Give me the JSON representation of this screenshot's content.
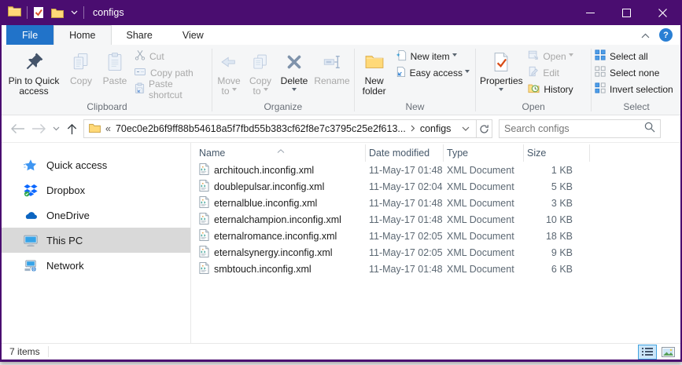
{
  "window": {
    "title": "configs"
  },
  "colors": {
    "titlebar_accent": "#4a0d70",
    "file_tab_blue": "#2173c9",
    "sidebar_selection": "#d9d9d9",
    "active_view_toggle_bg": "#cbe6f9",
    "active_view_toggle_border": "#42a3e0"
  },
  "icons": {
    "help_glyph": "?",
    "breadcrumb_overflow": "«"
  },
  "ribbon": {
    "tabs": {
      "file": "File",
      "home": "Home",
      "share": "Share",
      "view": "View"
    },
    "clipboard": {
      "label": "Clipboard",
      "pin": "Pin to Quick access",
      "copy": "Copy",
      "paste": "Paste",
      "cut": "Cut",
      "copy_path": "Copy path",
      "paste_shortcut": "Paste shortcut"
    },
    "organize": {
      "label": "Organize",
      "move_to": "Move to",
      "copy_to": "Copy to",
      "delete": "Delete",
      "rename": "Rename"
    },
    "new_group": {
      "label": "New",
      "new_folder": "New folder",
      "new_item": "New item",
      "easy_access": "Easy access"
    },
    "open_group": {
      "label": "Open",
      "properties": "Properties",
      "open": "Open",
      "edit": "Edit",
      "history": "History"
    },
    "select_group": {
      "label": "Select",
      "select_all": "Select all",
      "select_none": "Select none",
      "invert": "Invert selection"
    }
  },
  "address": {
    "parent": "70ec0e2b6f9ff88b54618a5f7fbd55b383cf62f8e7c3795c25e2f613...",
    "current": "configs",
    "search_placeholder": "Search configs"
  },
  "sidebar": {
    "items": [
      {
        "label": "Quick access",
        "icon": "quick-access-star-icon",
        "selected": false
      },
      {
        "label": "Dropbox",
        "icon": "dropbox-icon",
        "selected": false
      },
      {
        "label": "OneDrive",
        "icon": "onedrive-icon",
        "selected": false
      },
      {
        "label": "This PC",
        "icon": "this-pc-icon",
        "selected": true
      },
      {
        "label": "Network",
        "icon": "network-icon",
        "selected": false
      }
    ]
  },
  "files": {
    "columns": {
      "name": "Name",
      "date": "Date modified",
      "type": "Type",
      "size": "Size"
    },
    "rows": [
      {
        "name": "architouch.inconfig.xml",
        "date": "11-May-17 01:48",
        "type": "XML Document",
        "size": "1 KB"
      },
      {
        "name": "doublepulsar.inconfig.xml",
        "date": "11-May-17 02:04",
        "type": "XML Document",
        "size": "5 KB"
      },
      {
        "name": "eternalblue.inconfig.xml",
        "date": "11-May-17 01:48",
        "type": "XML Document",
        "size": "3 KB"
      },
      {
        "name": "eternalchampion.inconfig.xml",
        "date": "11-May-17 01:48",
        "type": "XML Document",
        "size": "10 KB"
      },
      {
        "name": "eternalromance.inconfig.xml",
        "date": "11-May-17 02:05",
        "type": "XML Document",
        "size": "18 KB"
      },
      {
        "name": "eternalsynergy.inconfig.xml",
        "date": "11-May-17 02:05",
        "type": "XML Document",
        "size": "9 KB"
      },
      {
        "name": "smbtouch.inconfig.xml",
        "date": "11-May-17 01:48",
        "type": "XML Document",
        "size": "6 KB"
      }
    ]
  },
  "status": {
    "items": "7 items"
  }
}
